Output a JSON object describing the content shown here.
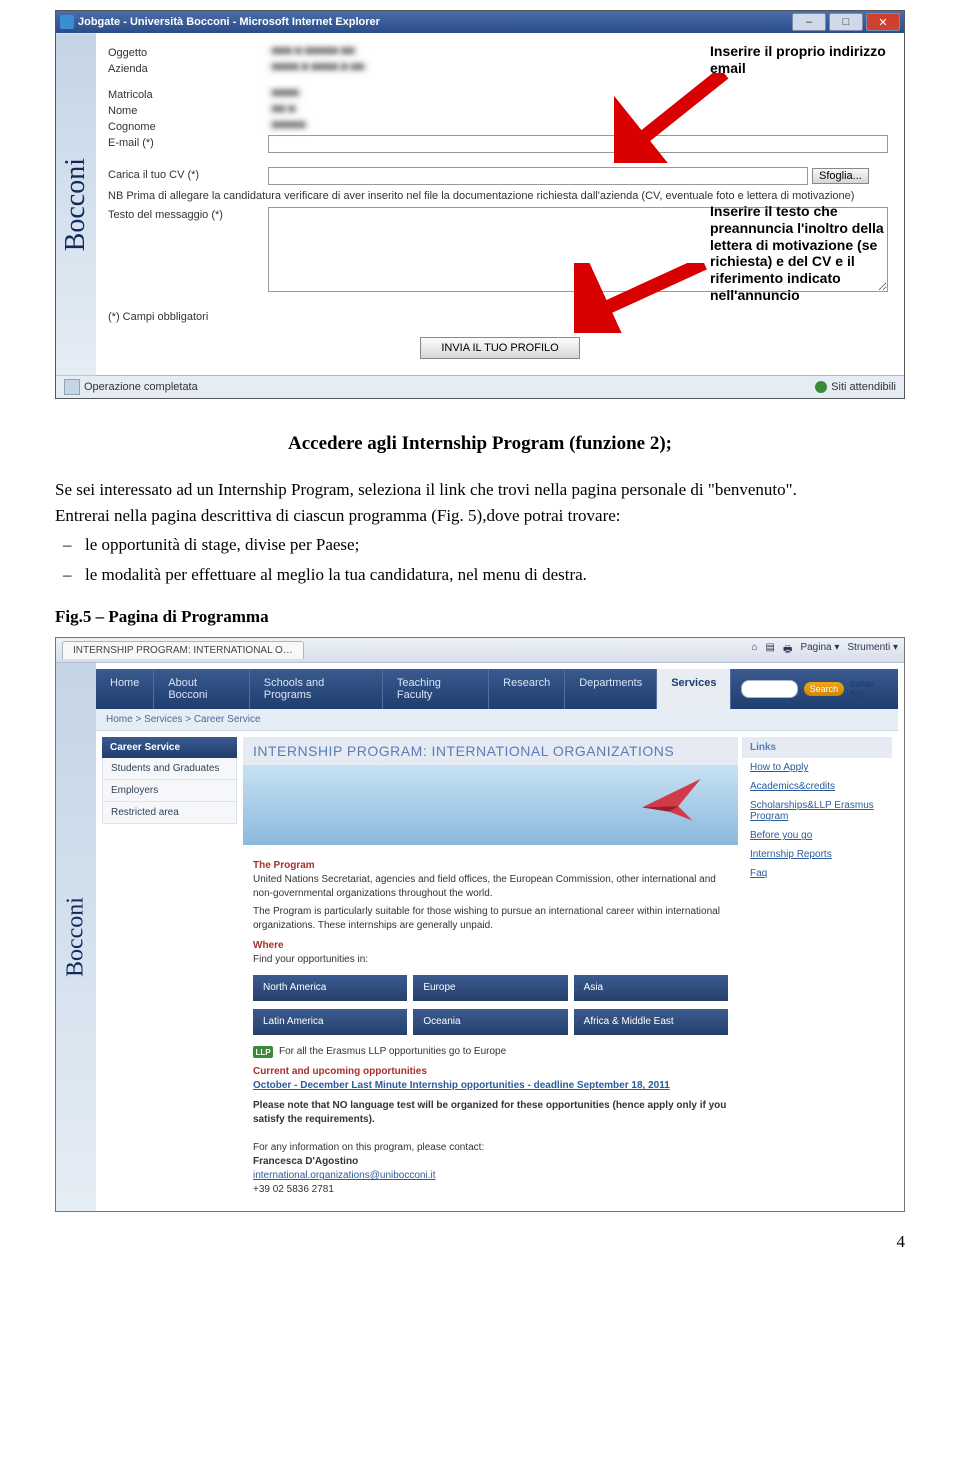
{
  "ie1": {
    "title": "Jobgate - Università Bocconi - Microsoft Internet Explorer",
    "logo_text": "Bocconi",
    "labels": {
      "oggetto": "Oggetto",
      "azienda": "Azienda",
      "matricola": "Matricola",
      "nome": "Nome",
      "cognome": "Cognome",
      "email": "E-mail (*)",
      "caricacv": "Carica il tuo CV (*)",
      "sfoglia": "Sfoglia...",
      "nb": "NB Prima di allegare la candidatura verificare di aver inserito nel file la documentazione richiesta dall'azienda (CV, eventuale foto e lettera di motivazione)",
      "testo": "Testo del messaggio (*)",
      "obblig": "(*) Campi obbligatori",
      "submit": "INVIA IL TUO PROFILO"
    },
    "status": {
      "left": "Operazione completata",
      "right": "Siti attendibili"
    },
    "callout1": "Inserire il proprio indirizzo email",
    "callout2": "Inserire il testo che preannuncia l'inoltro della lettera di motivazione (se richiesta) e del CV e il riferimento indicato nell'annuncio"
  },
  "section_title": "Accedere agli Internship Program (funzione 2);",
  "body": {
    "p1": "Se sei interessato ad un Internship Program, seleziona il link che trovi nella pagina personale di \"benvenuto\".",
    "p2": "Entrerai nella pagina descrittiva di ciascun programma (Fig. 5),dove potrai trovare:",
    "li1": "le opportunità di stage, divise per Paese;",
    "li2": "le modalità per effettuare al meglio la tua candidatura, nel menu di destra."
  },
  "fig_caption": "Fig.5 – Pagina di Programma",
  "ie2": {
    "tab": "INTERNSHIP PROGRAM: INTERNATIONAL ORGANIZA...",
    "tool_pagina": "Pagina",
    "tool_strumenti": "Strumenti",
    "logo_text": "Bocconi",
    "nav": [
      "Home",
      "About Bocconi",
      "Schools and Programs",
      "Teaching Faculty",
      "Research",
      "Departments",
      "Services"
    ],
    "search_btn": "Search",
    "lang": "Italian Site",
    "breadcrumb": "Home > Services > Career Service",
    "left": {
      "hdr": "Career Service",
      "items": [
        "Students and Graduates",
        "Employers",
        "Restricted area"
      ]
    },
    "page_h": "INTERNSHIP PROGRAM: INTERNATIONAL ORGANIZATIONS",
    "program": {
      "h1": "The Program",
      "p1": "United Nations Secretariat, agencies and field offices, the European Commission, other international and non-governmental organizations throughout the world.",
      "p2": "The Program is particularly suitable for those wishing to pursue an international career within international organizations. These internships are generally unpaid.",
      "h2": "Where",
      "p3": "Find your opportunities in:",
      "regions1": [
        "North America",
        "Europe",
        "Asia"
      ],
      "regions2": [
        "Latin America",
        "Oceania",
        "Africa & Middle East"
      ],
      "llp_icon": "LLP",
      "llp": "For all the Erasmus LLP opportunities go to Europe",
      "h3": "Current and upcoming opportunities",
      "deadline": "October - December Last Minute Internship opportunities - deadline September 18, 2011",
      "note": "Please note that NO language test will be organized for these opportunities (hence apply only if you satisfy the requirements).",
      "contact_intro": "For any information on this program, please contact:",
      "contact_name": "Francesca D'Agostino",
      "contact_email": "international.organizations@unibocconi.it",
      "contact_phone": "+39 02 5836 2781"
    },
    "right": {
      "hdr": "Links",
      "items": [
        "How to Apply",
        "Academics&credits",
        "Scholarships&LLP Erasmus Program",
        "Before you go",
        "Internship Reports",
        "Faq"
      ]
    }
  },
  "page_number": "4"
}
